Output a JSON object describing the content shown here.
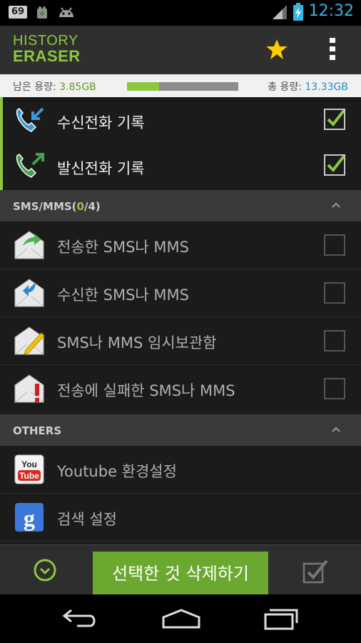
{
  "status_bar": {
    "badge": "69",
    "time": "12:32"
  },
  "app": {
    "logo_line1": "HISTORY",
    "logo_line2": "ERASER"
  },
  "storage": {
    "free_label": "남은 용량:",
    "free_value": "3.85GB",
    "total_label": "총 용량:",
    "total_value": "13.33GB",
    "used_fraction": 0.29
  },
  "call_items": [
    {
      "label": "수신전화 기록",
      "checked": true
    },
    {
      "label": "발신전화 기록",
      "checked": true
    }
  ],
  "sms_section": {
    "prefix": "SMS/MMS(",
    "count": "0",
    "suffix": "/4)"
  },
  "sms_items": [
    {
      "label": "전송한 SMS나 MMS"
    },
    {
      "label": "수신한 SMS나 MMS"
    },
    {
      "label": "SMS나 MMS 임시보관함"
    },
    {
      "label": "전송에 실패한 SMS나 MMS"
    }
  ],
  "others_section": {
    "title": "OTHERS"
  },
  "others_items": [
    {
      "label": "Youtube 환경설정"
    },
    {
      "label": "검색 설정"
    }
  ],
  "bottom": {
    "delete_label": "선택한 것 삭제하기"
  },
  "colors": {
    "accent_green": "#8dc63f",
    "time_blue": "#33b5e5",
    "storage_blue": "#1a8fcf"
  }
}
